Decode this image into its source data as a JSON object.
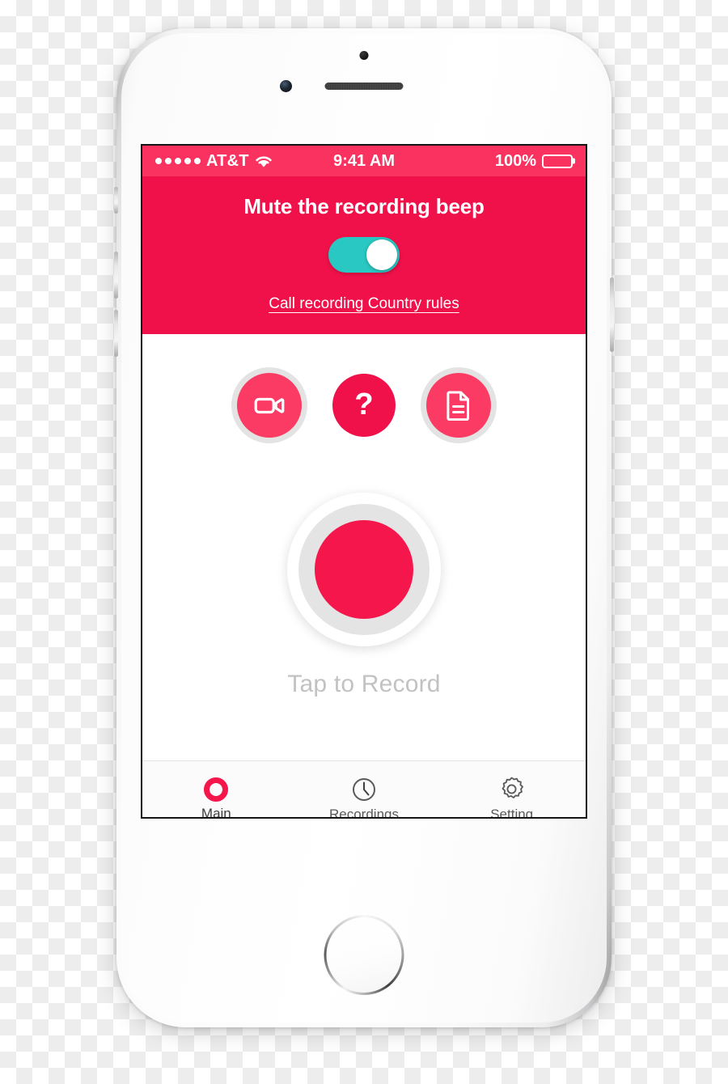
{
  "device": {
    "name": "white-iphone-mockup",
    "camera_icon": "front-camera-icon",
    "speaker_icon": "earpiece-speaker-icon",
    "home_button": "home-button"
  },
  "status_bar": {
    "signal_dots": 5,
    "carrier": "AT&T",
    "wifi_icon": "wifi-icon",
    "time": "9:41 AM",
    "battery_percent": "100%",
    "battery_level": 100
  },
  "header": {
    "title": "Mute the recording beep",
    "toggle": {
      "state": "on",
      "on_color": "#2ac8c2",
      "knob_color": "#ffffff"
    },
    "link": "Call recording Country rules",
    "background_color": "#f0114a"
  },
  "actions": [
    {
      "name": "video-record-button",
      "icon": "video-camera-icon",
      "label": ""
    },
    {
      "name": "help-button",
      "icon": "question-mark-icon",
      "label": "?"
    },
    {
      "name": "notes-button",
      "icon": "document-icon",
      "label": ""
    }
  ],
  "record": {
    "button_name": "record-button",
    "caption": "Tap to Record",
    "inner_color": "#f5164c"
  },
  "tabs": [
    {
      "label": "Main",
      "icon": "record-ring-icon",
      "active": true
    },
    {
      "label": "Recordings",
      "icon": "clock-icon",
      "active": false
    },
    {
      "label": "Setting",
      "icon": "gear-icon",
      "active": false
    }
  ],
  "colors": {
    "accent": "#f0114a",
    "status_bar": "#fa325f",
    "toggle_on": "#2ac8c2",
    "muted_text": "#c2c2c2"
  }
}
